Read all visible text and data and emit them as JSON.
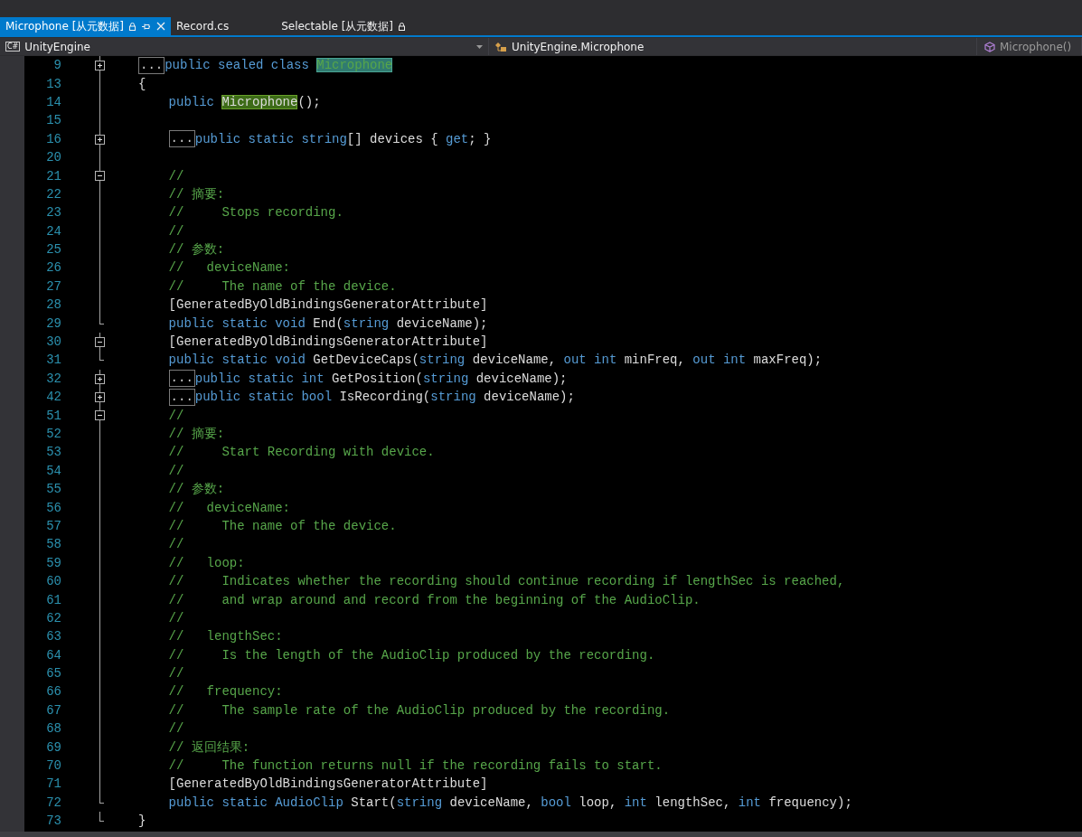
{
  "tabs": [
    {
      "label": "Microphone [从元数据]",
      "selected": true,
      "locked": true
    },
    {
      "label": "Record.cs",
      "selected": false,
      "locked": false
    },
    {
      "label": "Selectable [从元数据]",
      "selected": false,
      "locked": true
    }
  ],
  "navigation_bar": [
    {
      "kind": "project",
      "icon_text": "C#",
      "label": "UnityEngine"
    },
    {
      "kind": "class",
      "label": "UnityEngine.Microphone"
    },
    {
      "kind": "member",
      "label": "Microphone()"
    }
  ],
  "editor": {
    "lines": [
      {
        "number": "9",
        "kind": "region-start",
        "expanded": false,
        "collapsed_label": "...",
        "segments": [
          {
            "kind": "keyword",
            "text": "public sealed class "
          },
          {
            "kind": "definition",
            "text": "Microphone"
          }
        ]
      },
      {
        "number": "13",
        "kind": "body",
        "segments": [
          {
            "kind": "plain",
            "text": "{"
          }
        ],
        "children": [
          {
            "number": "14",
            "kind": "body",
            "segments": [
              {
                "kind": "keyword",
                "text": "public "
              },
              {
                "kind": "reference",
                "text": "Microphone"
              },
              {
                "kind": "plain",
                "text": "();"
              }
            ]
          },
          {
            "number": "15",
            "kind": "body"
          },
          {
            "number": "16",
            "kind": "region-start",
            "expanded": false,
            "collapsed_label": "...",
            "segments": [
              {
                "kind": "keyword",
                "text": "public static string"
              },
              {
                "kind": "plain",
                "text": "[] devices { "
              },
              {
                "kind": "keyword",
                "text": "get"
              },
              {
                "kind": "plain",
                "text": "; }"
              }
            ]
          },
          {
            "number": "20",
            "kind": "body"
          },
          {
            "number": "21",
            "kind": "region-start",
            "expanded": true,
            "segments": [
              {
                "kind": "comment",
                "text": "//"
              }
            ]
          },
          {
            "number": "22",
            "kind": "body",
            "segments": [
              {
                "kind": "comment",
                "text": "// 摘要:"
              }
            ]
          },
          {
            "number": "23",
            "kind": "body",
            "segments": [
              {
                "kind": "comment",
                "text": "//     Stops recording."
              }
            ]
          },
          {
            "number": "24",
            "kind": "body",
            "segments": [
              {
                "kind": "comment",
                "text": "//"
              }
            ]
          },
          {
            "number": "25",
            "kind": "body",
            "segments": [
              {
                "kind": "comment",
                "text": "// 参数:"
              }
            ]
          },
          {
            "number": "26",
            "kind": "body",
            "segments": [
              {
                "kind": "comment",
                "text": "//   deviceName:"
              }
            ]
          },
          {
            "number": "27",
            "kind": "body",
            "segments": [
              {
                "kind": "comment",
                "text": "//     The name of the device."
              }
            ]
          },
          {
            "number": "28",
            "kind": "body",
            "segments": [
              {
                "kind": "plain",
                "text": "[GeneratedByOldBindingsGeneratorAttribute]"
              }
            ]
          },
          {
            "number": "29",
            "kind": "region-end",
            "segments": [
              {
                "kind": "keyword",
                "text": "public static void "
              },
              {
                "kind": "plain",
                "text": "End("
              },
              {
                "kind": "keyword",
                "text": "string"
              },
              {
                "kind": "plain",
                "text": " deviceName);"
              }
            ]
          },
          {
            "number": "30",
            "kind": "region-start",
            "expanded": true,
            "segments": [
              {
                "kind": "plain",
                "text": "[GeneratedByOldBindingsGeneratorAttribute]"
              }
            ]
          },
          {
            "number": "31",
            "kind": "region-end",
            "segments": [
              {
                "kind": "keyword",
                "text": "public static void "
              },
              {
                "kind": "plain",
                "text": "GetDeviceCaps("
              },
              {
                "kind": "keyword",
                "text": "string"
              },
              {
                "kind": "plain",
                "text": " deviceName, "
              },
              {
                "kind": "keyword",
                "text": "out int"
              },
              {
                "kind": "plain",
                "text": " minFreq, "
              },
              {
                "kind": "keyword",
                "text": "out int"
              },
              {
                "kind": "plain",
                "text": " maxFreq);"
              }
            ]
          },
          {
            "number": "32",
            "kind": "region-start",
            "expanded": false,
            "collapsed_label": "...",
            "segments": [
              {
                "kind": "keyword",
                "text": "public static int "
              },
              {
                "kind": "plain",
                "text": "GetPosition("
              },
              {
                "kind": "keyword",
                "text": "string"
              },
              {
                "kind": "plain",
                "text": " deviceName);"
              }
            ]
          },
          {
            "number": "42",
            "kind": "region-start",
            "expanded": false,
            "collapsed_label": "...",
            "segments": [
              {
                "kind": "keyword",
                "text": "public static bool "
              },
              {
                "kind": "plain",
                "text": "IsRecording("
              },
              {
                "kind": "keyword",
                "text": "string"
              },
              {
                "kind": "plain",
                "text": " deviceName);"
              }
            ]
          },
          {
            "number": "51",
            "kind": "region-start",
            "expanded": true,
            "segments": [
              {
                "kind": "comment",
                "text": "//"
              }
            ]
          },
          {
            "number": "52",
            "kind": "body",
            "segments": [
              {
                "kind": "comment",
                "text": "// 摘要:"
              }
            ]
          },
          {
            "number": "53",
            "kind": "body",
            "segments": [
              {
                "kind": "comment",
                "text": "//     Start Recording with device."
              }
            ]
          },
          {
            "number": "54",
            "kind": "body",
            "segments": [
              {
                "kind": "comment",
                "text": "//"
              }
            ]
          },
          {
            "number": "55",
            "kind": "body",
            "segments": [
              {
                "kind": "comment",
                "text": "// 参数:"
              }
            ]
          },
          {
            "number": "56",
            "kind": "body",
            "segments": [
              {
                "kind": "comment",
                "text": "//   deviceName:"
              }
            ]
          },
          {
            "number": "57",
            "kind": "body",
            "segments": [
              {
                "kind": "comment",
                "text": "//     The name of the device."
              }
            ]
          },
          {
            "number": "58",
            "kind": "body",
            "segments": [
              {
                "kind": "comment",
                "text": "//"
              }
            ]
          },
          {
            "number": "59",
            "kind": "body",
            "segments": [
              {
                "kind": "comment",
                "text": "//   loop:"
              }
            ]
          },
          {
            "number": "60",
            "kind": "body",
            "segments": [
              {
                "kind": "comment",
                "text": "//     Indicates whether the recording should continue recording if lengthSec is reached,"
              }
            ]
          },
          {
            "number": "61",
            "kind": "body",
            "segments": [
              {
                "kind": "comment",
                "text": "//     and wrap around and record from the beginning of the AudioClip."
              }
            ]
          },
          {
            "number": "62",
            "kind": "body",
            "segments": [
              {
                "kind": "comment",
                "text": "//"
              }
            ]
          },
          {
            "number": "63",
            "kind": "body",
            "segments": [
              {
                "kind": "comment",
                "text": "//   lengthSec:"
              }
            ]
          },
          {
            "number": "64",
            "kind": "body",
            "segments": [
              {
                "kind": "comment",
                "text": "//     Is the length of the AudioClip produced by the recording."
              }
            ]
          },
          {
            "number": "65",
            "kind": "body",
            "segments": [
              {
                "kind": "comment",
                "text": "//"
              }
            ]
          },
          {
            "number": "66",
            "kind": "body",
            "segments": [
              {
                "kind": "comment",
                "text": "//   frequency:"
              }
            ]
          },
          {
            "number": "67",
            "kind": "body",
            "segments": [
              {
                "kind": "comment",
                "text": "//     The sample rate of the AudioClip produced by the recording."
              }
            ]
          },
          {
            "number": "68",
            "kind": "body",
            "segments": [
              {
                "kind": "comment",
                "text": "//"
              }
            ]
          },
          {
            "number": "69",
            "kind": "body",
            "segments": [
              {
                "kind": "comment",
                "text": "// 返回结果:"
              }
            ]
          },
          {
            "number": "70",
            "kind": "body",
            "segments": [
              {
                "kind": "comment",
                "text": "//     The function returns null if the recording fails to start."
              }
            ]
          },
          {
            "number": "71",
            "kind": "body",
            "segments": [
              {
                "kind": "plain",
                "text": "[GeneratedByOldBindingsGeneratorAttribute]"
              }
            ]
          },
          {
            "number": "72",
            "kind": "region-end",
            "segments": [
              {
                "kind": "keyword",
                "text": "public static AudioClip "
              },
              {
                "kind": "plain",
                "text": "Start("
              },
              {
                "kind": "keyword",
                "text": "string"
              },
              {
                "kind": "plain",
                "text": " deviceName, "
              },
              {
                "kind": "keyword",
                "text": "bool"
              },
              {
                "kind": "plain",
                "text": " loop, "
              },
              {
                "kind": "keyword",
                "text": "int"
              },
              {
                "kind": "plain",
                "text": " lengthSec, "
              },
              {
                "kind": "keyword",
                "text": "int"
              },
              {
                "kind": "plain",
                "text": " frequency);"
              }
            ]
          }
        ]
      },
      {
        "number": "73",
        "kind": "region-end",
        "segments": [
          {
            "kind": "plain",
            "text": "}"
          }
        ]
      }
    ]
  }
}
